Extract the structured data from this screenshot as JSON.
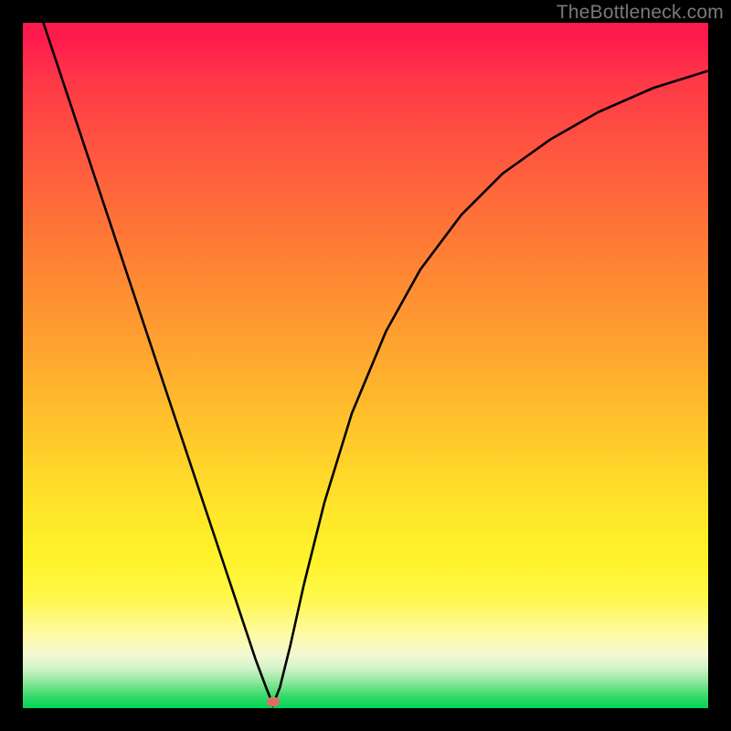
{
  "watermark": "TheBottleneck.com",
  "marker": {
    "x_pct": 36.5,
    "y_pct": 99.0,
    "color": "#e46a6a"
  },
  "chart_data": {
    "type": "line",
    "title": "",
    "xlabel": "",
    "ylabel": "",
    "xlim": [
      0,
      100
    ],
    "ylim": [
      0,
      100
    ],
    "grid": false,
    "legend": false,
    "series": [
      {
        "name": "bottleneck-curve",
        "x": [
          3,
          6,
          9,
          12,
          15,
          18,
          21,
          24,
          27,
          30,
          32,
          34,
          35.5,
          36.5,
          37.5,
          39,
          41,
          44,
          48,
          53,
          58,
          64,
          70,
          77,
          84,
          92,
          100
        ],
        "y": [
          100,
          91,
          82,
          73,
          64,
          55,
          46,
          37,
          28,
          19,
          13,
          7,
          3,
          0.5,
          3,
          9,
          18,
          30,
          43,
          55,
          64,
          72,
          78,
          83,
          87,
          90.5,
          93
        ],
        "color": "#000000"
      }
    ],
    "background_gradient": {
      "type": "vertical",
      "stops": [
        {
          "pct": 0,
          "color": "#ff1a4d"
        },
        {
          "pct": 34,
          "color": "#ff8035"
        },
        {
          "pct": 60,
          "color": "#ffc72b"
        },
        {
          "pct": 84,
          "color": "#fff84a"
        },
        {
          "pct": 92,
          "color": "#f5f8d2"
        },
        {
          "pct": 100,
          "color": "#00d355"
        }
      ]
    },
    "annotations": [
      {
        "kind": "point",
        "x": 36.5,
        "y": 0.5,
        "color": "#e46a6a"
      }
    ]
  }
}
